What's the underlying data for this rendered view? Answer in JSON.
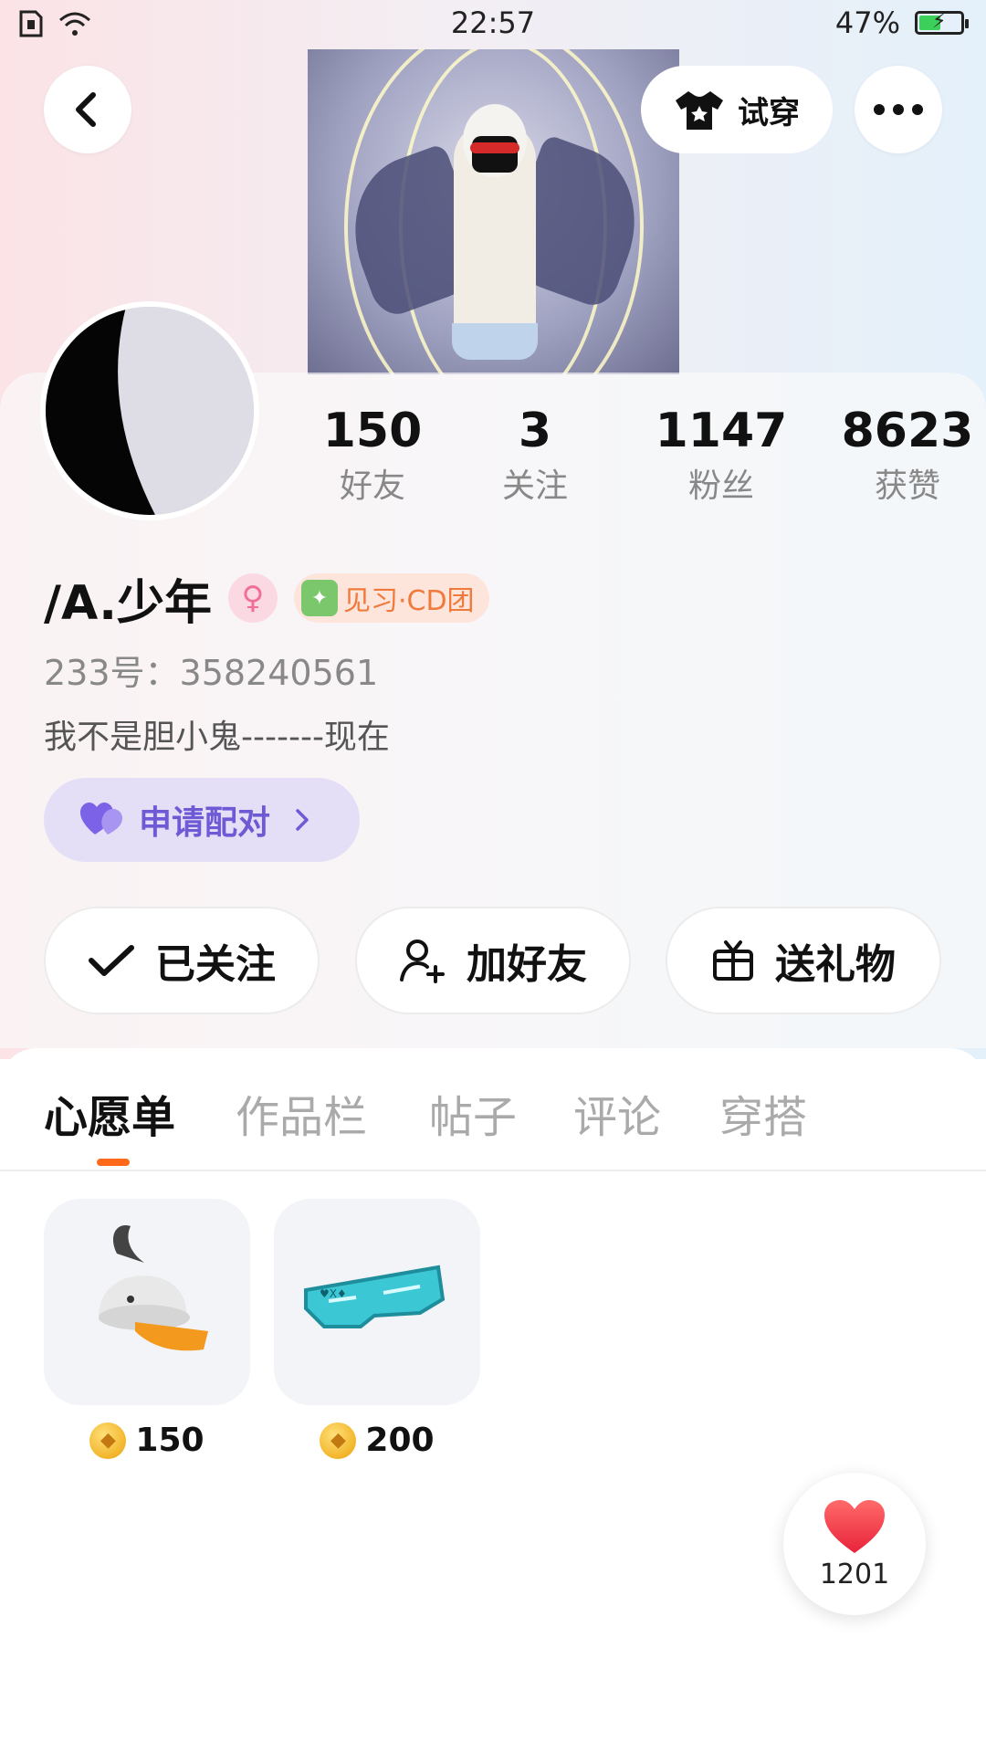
{
  "status_bar": {
    "time": "22:57",
    "battery": "47%",
    "battery_level": 0.47
  },
  "header": {
    "try_on_label": "试穿"
  },
  "stats": [
    {
      "value": "150",
      "label": "好友"
    },
    {
      "value": "3",
      "label": "关注"
    },
    {
      "value": "1147",
      "label": "粉丝"
    },
    {
      "value": "8623",
      "label": "获赞"
    }
  ],
  "profile": {
    "username": "/A.少年",
    "level_badge": "见习·CD团",
    "id_line": "233号：358240561",
    "bio": "我不是胆小鬼-------现在",
    "pair_label": "申请配对"
  },
  "actions": {
    "followed": "已关注",
    "add_friend": "加好友",
    "send_gift": "送礼物"
  },
  "tabs": [
    "心愿单",
    "作品栏",
    "帖子",
    "评论",
    "穿搭"
  ],
  "wishlist": [
    {
      "icon": "bunny-cap-icon",
      "price": "150"
    },
    {
      "icon": "cyber-visor-icon",
      "price": "200"
    }
  ],
  "likes": {
    "count": "1201"
  },
  "colors": {
    "accent_orange": "#ff6a1a",
    "pair_purple": "#6f5ad6",
    "like_red": "#f23a4a"
  }
}
